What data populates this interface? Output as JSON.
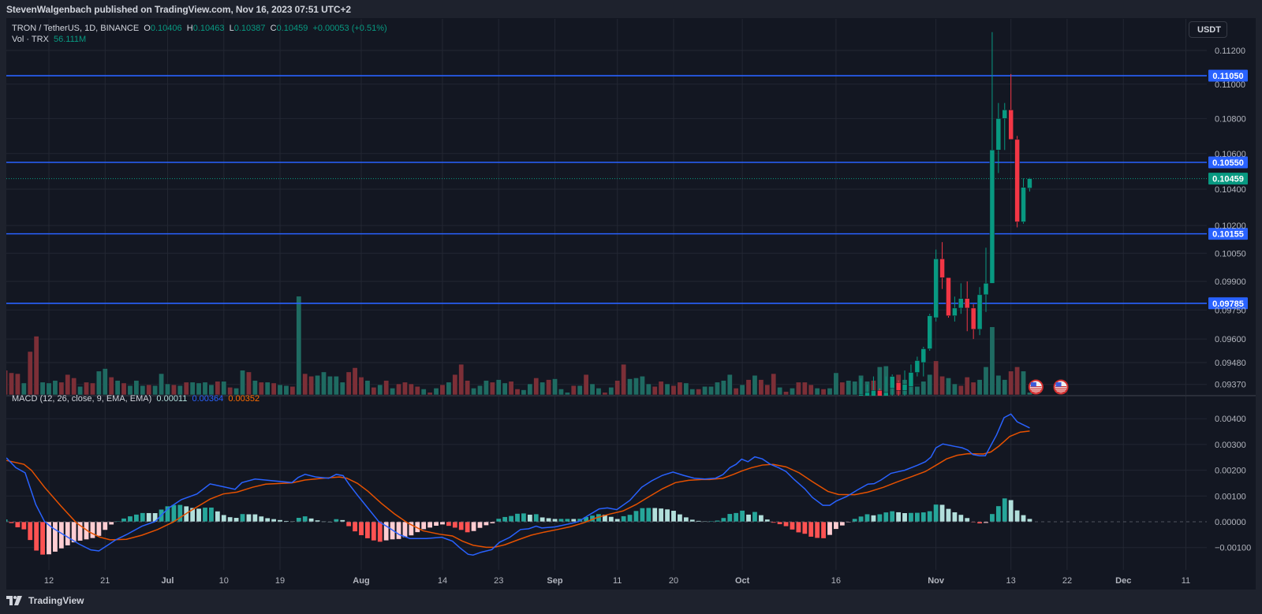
{
  "header": {
    "publish_line": "StevenWalgenbach published on TradingView.com, Nov 16, 2023 07:51 UTC+2"
  },
  "legend": {
    "symbol": "TRON / TetherUS, 1D, BINANCE",
    "o_label": "O",
    "o_value": "0.10406",
    "h_label": "H",
    "h_value": "0.10463",
    "l_label": "L",
    "l_value": "0.10387",
    "c_label": "C",
    "c_value": "0.10459",
    "change": "+0.00053 (+0.51%)",
    "vol_label": "Vol · TRX",
    "vol_value": "56.111M"
  },
  "macd_legend": {
    "label": "MACD (12, 26, close, 9, EMA, EMA)",
    "hist": "0.00011",
    "macd": "0.00364",
    "signal": "0.00352"
  },
  "currency_button": "USDT",
  "footer": {
    "brand": "TradingView"
  },
  "colors": {
    "up": "#089981",
    "down": "#f23645",
    "level_line": "#2962ff",
    "macd": "#2962ff",
    "signal": "#ff6d00",
    "vol_up": "#1f6b62",
    "vol_down": "#7c2f37",
    "hist_up_strong": "#26a69a",
    "hist_up_weak": "#b2dfdb",
    "hist_down_strong": "#ff5252",
    "hist_down_weak": "#ffcdd2"
  },
  "chart_data": {
    "type": "candlestick",
    "x_unit": "days since 2023-06-12",
    "price_axis": {
      "scale": "log",
      "ticks": [
        "0.11200",
        "0.11000",
        "0.10800",
        "0.10600",
        "0.10400",
        "0.10200",
        "0.10050",
        "0.09900",
        "0.09750",
        "0.09600",
        "0.09480",
        "0.09370"
      ]
    },
    "time_ticks": [
      {
        "label": "12",
        "day": 0
      },
      {
        "label": "21",
        "day": 9
      },
      {
        "label": "Jul",
        "day": 19,
        "bold": true
      },
      {
        "label": "10",
        "day": 28
      },
      {
        "label": "19",
        "day": 37
      },
      {
        "label": "Aug",
        "day": 50,
        "bold": true
      },
      {
        "label": "14",
        "day": 63
      },
      {
        "label": "23",
        "day": 72
      },
      {
        "label": "Sep",
        "day": 81,
        "bold": true
      },
      {
        "label": "11",
        "day": 91
      },
      {
        "label": "20",
        "day": 100
      },
      {
        "label": "Oct",
        "day": 111,
        "bold": true
      },
      {
        "label": "16",
        "day": 126
      },
      {
        "label": "Nov",
        "day": 142,
        "bold": true
      },
      {
        "label": "13",
        "day": 154
      },
      {
        "label": "22",
        "day": 163
      },
      {
        "label": "Dec",
        "day": 172,
        "bold": true
      },
      {
        "label": "11",
        "day": 182
      }
    ],
    "levels": [
      {
        "label": "0.11050",
        "price": 0.1105
      },
      {
        "label": "0.10550",
        "price": 0.1055
      },
      {
        "label": "0.10155",
        "price": 0.10155
      },
      {
        "label": "0.09785",
        "price": 0.09785
      }
    ],
    "last_price": {
      "label": "0.10459",
      "price": 0.10459
    },
    "candles": [
      {
        "d": 130,
        "o": 0.0928,
        "h": 0.094,
        "l": 0.092,
        "c": 0.0932
      },
      {
        "d": 131,
        "o": 0.093,
        "h": 0.0937,
        "l": 0.0922,
        "c": 0.0933
      },
      {
        "d": 132,
        "o": 0.0929,
        "h": 0.0941,
        "l": 0.0921,
        "c": 0.0934
      },
      {
        "d": 133,
        "o": 0.0934,
        "h": 0.0935,
        "l": 0.092,
        "c": 0.0926
      },
      {
        "d": 134,
        "o": 0.0926,
        "h": 0.0941,
        "l": 0.092,
        "c": 0.0933
      },
      {
        "d": 135,
        "o": 0.0935,
        "h": 0.0942,
        "l": 0.093,
        "c": 0.0941
      },
      {
        "d": 136,
        "o": 0.0938,
        "h": 0.0939,
        "l": 0.093,
        "c": 0.0934
      },
      {
        "d": 137,
        "o": 0.0934,
        "h": 0.0944,
        "l": 0.093,
        "c": 0.0937
      },
      {
        "d": 138,
        "o": 0.0936,
        "h": 0.0947,
        "l": 0.0933,
        "c": 0.0943
      },
      {
        "d": 139,
        "o": 0.0943,
        "h": 0.0951,
        "l": 0.0941,
        "c": 0.0949
      },
      {
        "d": 140,
        "o": 0.0948,
        "h": 0.0956,
        "l": 0.0941,
        "c": 0.0955
      },
      {
        "d": 141,
        "o": 0.0955,
        "h": 0.0973,
        "l": 0.0954,
        "c": 0.0972
      },
      {
        "d": 142,
        "o": 0.0971,
        "h": 0.1007,
        "l": 0.0969,
        "c": 0.1002
      },
      {
        "d": 143,
        "o": 0.1002,
        "h": 0.1011,
        "l": 0.0986,
        "c": 0.0992
      },
      {
        "d": 144,
        "o": 0.0992,
        "h": 0.0992,
        "l": 0.0971,
        "c": 0.0972
      },
      {
        "d": 145,
        "o": 0.0972,
        "h": 0.0982,
        "l": 0.0969,
        "c": 0.0976
      },
      {
        "d": 146,
        "o": 0.0976,
        "h": 0.0989,
        "l": 0.0973,
        "c": 0.0981
      },
      {
        "d": 147,
        "o": 0.0981,
        "h": 0.099,
        "l": 0.0964,
        "c": 0.0976
      },
      {
        "d": 148,
        "o": 0.0976,
        "h": 0.0978,
        "l": 0.096,
        "c": 0.0965
      },
      {
        "d": 149,
        "o": 0.0965,
        "h": 0.0987,
        "l": 0.0962,
        "c": 0.0983
      },
      {
        "d": 150,
        "o": 0.0983,
        "h": 0.1008,
        "l": 0.0974,
        "c": 0.0989
      },
      {
        "d": 151,
        "o": 0.0989,
        "h": 0.1131,
        "l": 0.0989,
        "c": 0.1062
      },
      {
        "d": 152,
        "o": 0.1062,
        "h": 0.1089,
        "l": 0.1049,
        "c": 0.108
      },
      {
        "d": 153,
        "o": 0.108,
        "h": 0.1089,
        "l": 0.1062,
        "c": 0.1085
      },
      {
        "d": 154,
        "o": 0.1085,
        "h": 0.1106,
        "l": 0.1068,
        "c": 0.1068
      },
      {
        "d": 155,
        "o": 0.1068,
        "h": 0.107,
        "l": 0.1019,
        "c": 0.1022
      },
      {
        "d": 156,
        "o": 0.1022,
        "h": 0.1046,
        "l": 0.1021,
        "c": 0.1041
      },
      {
        "d": 157,
        "o": 0.10406,
        "h": 0.10463,
        "l": 0.10387,
        "c": 0.10459
      }
    ],
    "volume": {
      "unit": "M",
      "first_day": -7,
      "values": [
        551,
        494,
        475,
        266,
        969,
        1311,
        285,
        266,
        323,
        285,
        456,
        380,
        190,
        285,
        266,
        532,
        589,
        399,
        323,
        266,
        209,
        323,
        209,
        228,
        209,
        475,
        247,
        228,
        209,
        285,
        285,
        266,
        285,
        228,
        304,
        304,
        171,
        152,
        551,
        513,
        323,
        285,
        285,
        266,
        228,
        209,
        190,
        2204,
        475,
        418,
        437,
        513,
        418,
        418,
        285,
        513,
        608,
        399,
        323,
        171,
        228,
        323,
        152,
        247,
        285,
        247,
        190,
        133,
        57,
        152,
        228,
        285,
        456,
        684,
        323,
        152,
        209,
        323,
        285,
        342,
        266,
        304,
        133,
        114,
        247,
        380,
        285,
        342,
        361,
        133,
        57,
        209,
        209,
        456,
        247,
        152,
        57,
        171,
        323,
        684,
        361,
        380,
        418,
        247,
        190,
        304,
        247,
        209,
        285,
        266,
        133,
        133,
        190,
        190,
        285,
        323,
        456,
        152,
        228,
        342,
        437,
        342,
        228,
        475,
        171,
        76,
        152,
        285,
        285,
        228,
        152,
        133,
        152,
        494,
        285,
        323,
        304,
        437,
        304,
        323,
        627,
        646,
        418,
        456,
        342,
        285,
        190,
        304,
        456,
        760,
        418,
        380,
        247,
        209,
        399,
        285,
        342,
        627,
        1520,
        437,
        342,
        532,
        627,
        532,
        56.1
      ],
      "directions": "dddudduuudddudduududuuuduuududuuuududuudududuududduuuuudddudududdddudududdduuuduudduududuuudu duududduuuuddudduuduuuuudududddududdduduuduuuuduuuduuuuudduuddduuuuudduu"
    },
    "macd": {
      "params": "12, 26, close, 9, EMA, EMA",
      "macd_line": [
        [
          -6.8,
          0.00248
        ],
        [
          -5.3,
          0.0021
        ],
        [
          -3.8,
          0.0019
        ],
        [
          -2.1,
          0.00067
        ],
        [
          -0.7,
          1e-05
        ],
        [
          0.6,
          -0.00024
        ],
        [
          2.7,
          -0.00055
        ],
        [
          4.8,
          -0.00086
        ],
        [
          6.7,
          -0.00109
        ],
        [
          8,
          -0.00113
        ],
        [
          9.4,
          -0.00091
        ],
        [
          10.7,
          -0.0007
        ],
        [
          12.4,
          -0.0005
        ],
        [
          14.9,
          -0.00017
        ],
        [
          17,
          1e-05
        ],
        [
          19.1,
          0.00052
        ],
        [
          21.2,
          0.00086
        ],
        [
          23.7,
          0.00108
        ],
        [
          25.8,
          0.00147
        ],
        [
          27.9,
          0.00136
        ],
        [
          29.8,
          0.00126
        ],
        [
          30.9,
          0.00152
        ],
        [
          33,
          0.00166
        ],
        [
          35.9,
          0.00159
        ],
        [
          38.9,
          0.00152
        ],
        [
          39.9,
          0.00172
        ],
        [
          41,
          0.00184
        ],
        [
          42.7,
          0.00174
        ],
        [
          44.8,
          0.00169
        ],
        [
          46,
          0.00184
        ],
        [
          47.1,
          0.00179
        ],
        [
          48.1,
          0.00144
        ],
        [
          49.4,
          0.00103
        ],
        [
          51.1,
          0.00052
        ],
        [
          52.8,
          1e-05
        ],
        [
          54.5,
          -0.00024
        ],
        [
          56.1,
          -0.0005
        ],
        [
          57.8,
          -0.00065
        ],
        [
          60.4,
          -0.00065
        ],
        [
          62.9,
          -0.0006
        ],
        [
          64.6,
          -0.00075
        ],
        [
          65.8,
          -0.00101
        ],
        [
          67.1,
          -0.00126
        ],
        [
          67.9,
          -0.00129
        ],
        [
          69.2,
          -0.00118
        ],
        [
          70.9,
          -0.00108
        ],
        [
          72.1,
          -0.0008
        ],
        [
          73.8,
          -0.0006
        ],
        [
          75.5,
          -0.0003
        ],
        [
          76.8,
          -0.00027
        ],
        [
          78,
          -0.00017
        ],
        [
          78.9,
          -0.00024
        ],
        [
          81,
          -0.0002
        ],
        [
          83.1,
          -9e-05
        ],
        [
          84.8,
          1e-05
        ],
        [
          86.5,
          0.00027
        ],
        [
          88.1,
          0.0005
        ],
        [
          89.4,
          0.00054
        ],
        [
          90.9,
          0.00047
        ],
        [
          93,
          0.00083
        ],
        [
          94.9,
          0.00134
        ],
        [
          96.5,
          0.00159
        ],
        [
          98.2,
          0.0018
        ],
        [
          99.9,
          0.00193
        ],
        [
          101.6,
          0.0018
        ],
        [
          103.3,
          0.00169
        ],
        [
          105,
          0.00166
        ],
        [
          106.7,
          0.00169
        ],
        [
          107.9,
          0.00183
        ],
        [
          109,
          0.0021
        ],
        [
          110,
          0.00223
        ],
        [
          110.9,
          0.00243
        ],
        [
          111.9,
          0.00233
        ],
        [
          113,
          0.00252
        ],
        [
          114.2,
          0.00244
        ],
        [
          115.5,
          0.00223
        ],
        [
          116.8,
          0.0021
        ],
        [
          118,
          0.00195
        ],
        [
          119.3,
          0.00164
        ],
        [
          121,
          0.00128
        ],
        [
          122.2,
          0.00095
        ],
        [
          123.9,
          0.00064
        ],
        [
          125,
          0.00064
        ],
        [
          126,
          0.0008
        ],
        [
          127.7,
          0.00098
        ],
        [
          129.4,
          0.00123
        ],
        [
          131.1,
          0.00146
        ],
        [
          132.1,
          0.00148
        ],
        [
          133.2,
          0.00162
        ],
        [
          134.8,
          0.00188
        ],
        [
          137,
          0.002
        ],
        [
          139.1,
          0.0022
        ],
        [
          140.3,
          0.00233
        ],
        [
          141.2,
          0.00251
        ],
        [
          142,
          0.00287
        ],
        [
          143.1,
          0.00302
        ],
        [
          144.9,
          0.00293
        ],
        [
          146.2,
          0.00287
        ],
        [
          147.1,
          0.00278
        ],
        [
          147.9,
          0.00261
        ],
        [
          149,
          0.00256
        ],
        [
          149.9,
          0.00256
        ],
        [
          151.7,
          0.00337
        ],
        [
          152.9,
          0.00404
        ],
        [
          154,
          0.00418
        ],
        [
          155,
          0.00388
        ],
        [
          157,
          0.00364
        ]
      ],
      "signal_line": [
        [
          -6.8,
          0.00238
        ],
        [
          -4,
          0.00223
        ],
        [
          -2.8,
          0.002
        ],
        [
          -0.7,
          0.00134
        ],
        [
          1.9,
          0.00062
        ],
        [
          4.4,
          -4e-05
        ],
        [
          6.5,
          -0.0004
        ],
        [
          8.2,
          -0.0006
        ],
        [
          9.8,
          -0.0007
        ],
        [
          12.4,
          -0.00068
        ],
        [
          14.9,
          -0.00052
        ],
        [
          17.4,
          -0.0003
        ],
        [
          19.9,
          -1e-05
        ],
        [
          22.5,
          0.0004
        ],
        [
          25.8,
          0.00088
        ],
        [
          27.9,
          0.00108
        ],
        [
          30.1,
          0.00115
        ],
        [
          32.6,
          0.00134
        ],
        [
          34.7,
          0.00146
        ],
        [
          38.9,
          0.00151
        ],
        [
          41,
          0.00162
        ],
        [
          43.9,
          0.00169
        ],
        [
          46.5,
          0.00174
        ],
        [
          47.7,
          0.00169
        ],
        [
          49.4,
          0.00149
        ],
        [
          51.1,
          0.00118
        ],
        [
          53.2,
          0.00072
        ],
        [
          55.3,
          0.00031
        ],
        [
          57.4,
          -4e-05
        ],
        [
          59.9,
          -0.00035
        ],
        [
          62.5,
          -0.00048
        ],
        [
          64.6,
          -0.00055
        ],
        [
          66.2,
          -0.00075
        ],
        [
          67.9,
          -0.00091
        ],
        [
          70,
          -0.00099
        ],
        [
          71.3,
          -0.00099
        ],
        [
          73,
          -0.00089
        ],
        [
          75.1,
          -0.0007
        ],
        [
          77.2,
          -0.00052
        ],
        [
          79.3,
          -0.0004
        ],
        [
          81.4,
          -0.0003
        ],
        [
          83.5,
          -0.00019
        ],
        [
          85.6,
          -4e-05
        ],
        [
          87.7,
          0.00016
        ],
        [
          89.8,
          0.0003
        ],
        [
          91.9,
          0.00042
        ],
        [
          94,
          0.00067
        ],
        [
          96.1,
          0.00098
        ],
        [
          98.2,
          0.00128
        ],
        [
          100.3,
          0.00152
        ],
        [
          102.4,
          0.00161
        ],
        [
          104.5,
          0.00164
        ],
        [
          105.8,
          0.00164
        ],
        [
          107.9,
          0.00169
        ],
        [
          109.6,
          0.00184
        ],
        [
          110.9,
          0.00197
        ],
        [
          112.5,
          0.0021
        ],
        [
          114.2,
          0.0022
        ],
        [
          115.9,
          0.00223
        ],
        [
          118,
          0.00213
        ],
        [
          120.1,
          0.0019
        ],
        [
          122.2,
          0.00156
        ],
        [
          124.7,
          0.00118
        ],
        [
          126.4,
          0.00106
        ],
        [
          129,
          0.00105
        ],
        [
          131.1,
          0.00115
        ],
        [
          133.6,
          0.00134
        ],
        [
          135.7,
          0.00154
        ],
        [
          138.2,
          0.00176
        ],
        [
          140.3,
          0.00195
        ],
        [
          142.4,
          0.00225
        ],
        [
          143.7,
          0.00244
        ],
        [
          145.4,
          0.00258
        ],
        [
          147.1,
          0.00264
        ],
        [
          149.6,
          0.00263
        ],
        [
          150.8,
          0.00271
        ],
        [
          152.1,
          0.00294
        ],
        [
          153.8,
          0.00331
        ],
        [
          155.5,
          0.00348
        ],
        [
          157,
          0.00352
        ]
      ],
      "axis_ticks": [
        {
          "label": "0.00400",
          "v": 0.004
        },
        {
          "label": "0.00300",
          "v": 0.003
        },
        {
          "label": "0.00200",
          "v": 0.002
        },
        {
          "label": "0.00100",
          "v": 0.001
        },
        {
          "label": "0.00000",
          "v": 0
        },
        {
          "label": "−0.00100",
          "v": -0.001
        }
      ]
    },
    "events": [
      {
        "icon": "us-flag-icon",
        "day": 158
      },
      {
        "icon": "us-flag-icon",
        "day": 162
      }
    ]
  }
}
